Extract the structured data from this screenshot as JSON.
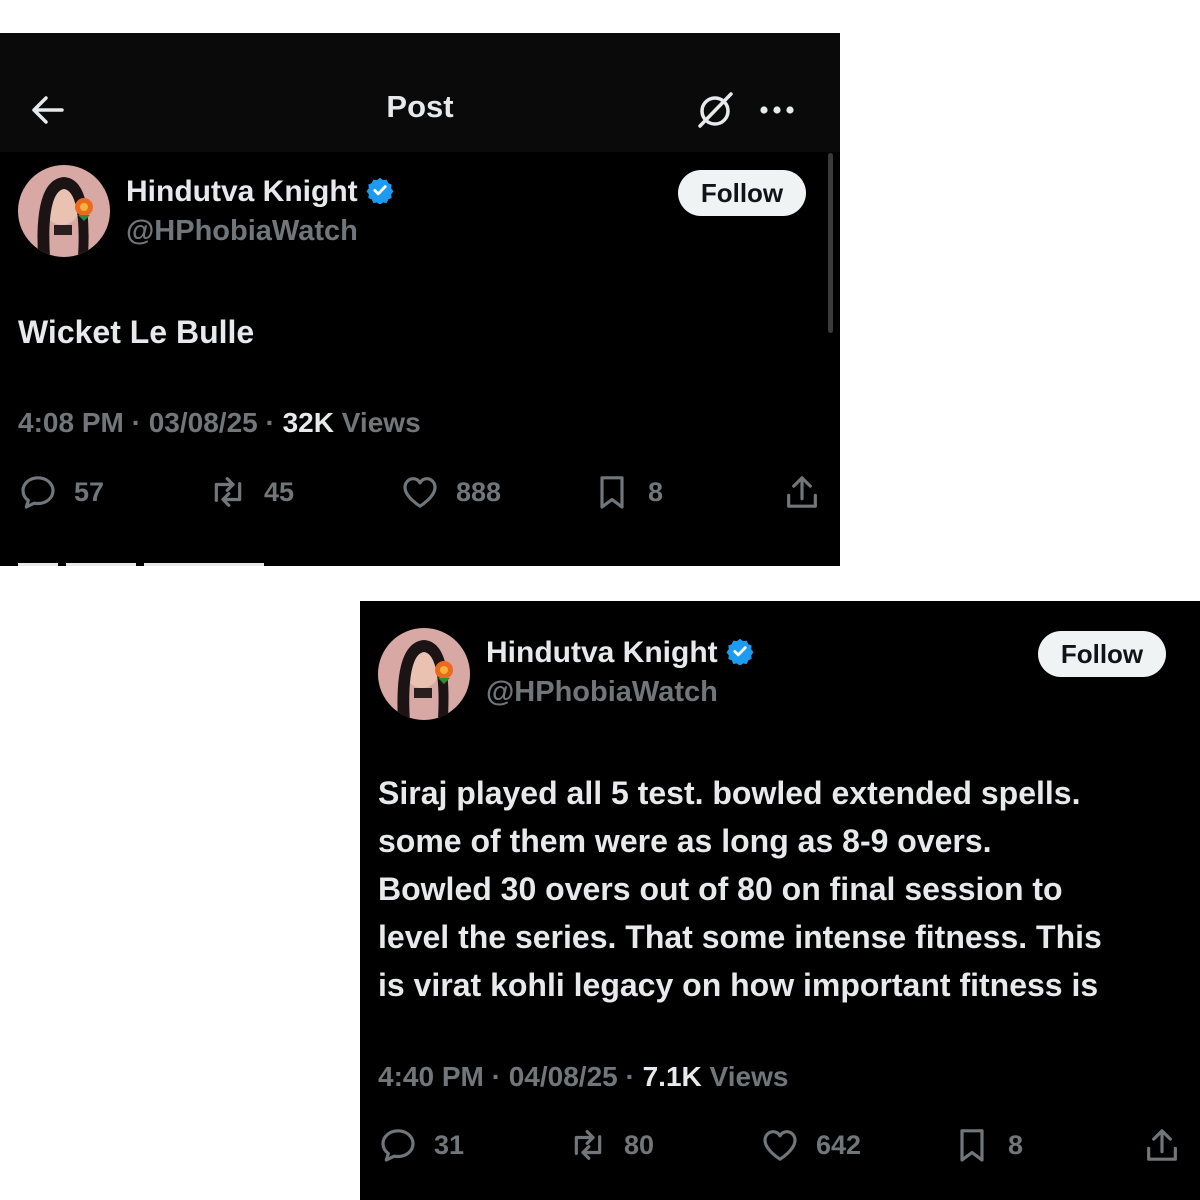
{
  "screen1": {
    "header": {
      "title": "Post"
    },
    "author": {
      "name": "Hindutva Knight",
      "handle": "@HPhobiaWatch"
    },
    "follow_label": "Follow",
    "tweet_text": "Wicket Le Bulle",
    "meta": {
      "time": "4:08 PM",
      "date": "03/08/25",
      "views_count": "32K",
      "views_label": "Views"
    },
    "actions": {
      "replies": "57",
      "reposts": "45",
      "likes": "888",
      "bookmarks": "8"
    }
  },
  "screen2": {
    "author": {
      "name": "Hindutva Knight",
      "handle": "@HPhobiaWatch"
    },
    "follow_label": "Follow",
    "tweet_lines": [
      "Siraj played all 5 test. bowled extended spells.",
      "some of them were as long as 8-9 overs.",
      "Bowled 30 overs out of 80 on final session to",
      "level the series. That some intense fitness. This",
      "is virat kohli legacy on how important fitness is"
    ],
    "meta": {
      "time": "4:40 PM",
      "date": "04/08/25",
      "views_count": "7.1K",
      "views_label": "Views"
    },
    "actions": {
      "replies": "31",
      "reposts": "80",
      "likes": "642",
      "bookmarks": "8"
    }
  },
  "colors": {
    "background": "#000000",
    "text": "#e7e9ea",
    "muted": "#71767b",
    "verified": "#1d9bf0",
    "follow_bg": "#eff3f4"
  }
}
